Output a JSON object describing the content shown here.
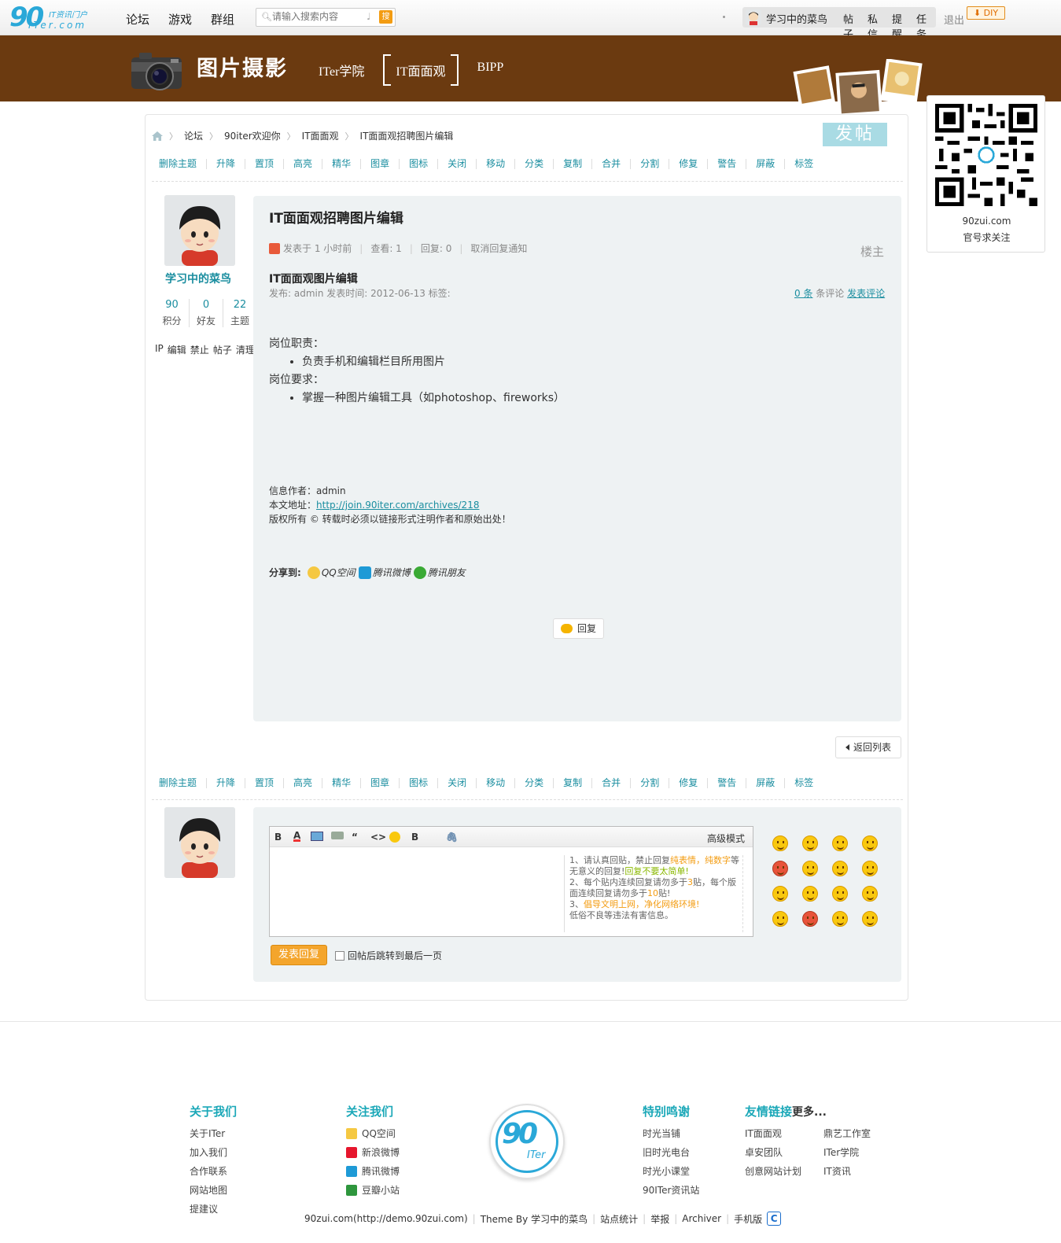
{
  "topnav": {
    "logo_text": "90",
    "logo_tagline": "IT资讯门户",
    "logo_domain": "ITer.com",
    "items": [
      "论坛",
      "游戏",
      "群组"
    ],
    "search_placeholder": "请输入搜索内容",
    "search_button": "搜",
    "username": "学习中的菜鸟",
    "user_links": [
      "帖子",
      "私信",
      "提醒",
      "任务"
    ],
    "logout": "退出",
    "diy": "DIY"
  },
  "banner": {
    "title": "图片摄影",
    "nav": [
      "ITer学院",
      "IT面面观",
      "BIPP"
    ],
    "active": "IT面面观"
  },
  "qr": {
    "site": "90zui.com",
    "caption": "官号求关注"
  },
  "breadcrumb": [
    "论坛",
    "90iter欢迎你",
    "IT面面观",
    "IT面面观招聘图片编辑"
  ],
  "post_button": "发帖",
  "mod_actions": [
    "删除主题",
    "升降",
    "置顶",
    "高亮",
    "精华",
    "图章",
    "图标",
    "关闭",
    "移动",
    "分类",
    "复制",
    "合并",
    "分割",
    "修复",
    "警告",
    "屏蔽",
    "标签"
  ],
  "author": {
    "name": "学习中的菜鸟",
    "stats": [
      {
        "value": "90",
        "label": "积分"
      },
      {
        "value": "0",
        "label": "好友"
      },
      {
        "value": "22",
        "label": "主题"
      }
    ],
    "links": [
      "IP",
      "编辑",
      "禁止",
      "帖子",
      "清理"
    ]
  },
  "post": {
    "title": "IT面面观招聘图片编辑",
    "posted": "发表于 1 小时前",
    "views": "查看: 1",
    "replies": "回复: 0",
    "unsubscribe": "取消回复通知",
    "floor": "楼主",
    "subtitle": "IT面面观图片编辑",
    "pubinfo": "发布: admin 发表时间: 2012-06-13 标签:",
    "comment_count": "0 条",
    "comment_label": "条评论",
    "comment_link": "发表评论",
    "duty_title": "岗位职责：",
    "duty_items": [
      "负责手机和编辑栏目所用图片"
    ],
    "req_title": "岗位要求：",
    "req_items": [
      "掌握一种图片编辑工具（如photoshop、fireworks）"
    ],
    "info_author": "信息作者：admin",
    "info_url_label": "本文地址：",
    "info_url": "http://join.90iter.com/archives/218",
    "copyright": "版权所有 © 转载时必须以链接形式注明作者和原始出处！",
    "share_label": "分享到:",
    "share_items": [
      "QQ空间",
      "腾讯微博",
      "腾讯朋友"
    ],
    "reply_button": "回复"
  },
  "back_list": "返回列表",
  "reply_form": {
    "advanced": "高级模式",
    "notice_1a": "请认真回贴，禁止回复",
    "notice_1b": "纯表情，纯数字",
    "notice_1c": "等无意义的回复!",
    "notice_1d": "回复不要太简单!",
    "notice_2a": "每个贴内连续回复请勿多于",
    "notice_2b": "3",
    "notice_2c": "贴，每个版面连续回复请勿多于",
    "notice_2d": "10",
    "notice_2e": "贴!",
    "notice_3a": "倡导文明上网，净化网络环境!",
    "notice_3b": "低俗不良等违法有害信息。",
    "submit": "发表回复",
    "jump_label": "回帖后跳转到最后一页"
  },
  "footer": {
    "about_title": "关于我们",
    "about_items": [
      "关于ITer",
      "加入我们",
      "合作联系",
      "网站地图",
      "提建议"
    ],
    "follow_title": "关注我们",
    "follow_items": [
      "QQ空间",
      "新浪微博",
      "腾讯微博",
      "豆瓣小站"
    ],
    "logo_text": "90",
    "logo_sub": "ITer",
    "thanks_title": "特别鸣谢",
    "thanks_items": [
      "时光当铺",
      "旧时光电台",
      "时光小课堂",
      "90ITer资讯站"
    ],
    "links_title": "友情链接",
    "links_more": "更多...",
    "links_col1": [
      "IT面面观",
      "卓安团队",
      "创意网站计划"
    ],
    "links_col2": [
      "鼎艺工作室",
      "ITer学院",
      "IT资讯"
    ],
    "bottom": [
      "90zui.com(http://demo.90zui.com)",
      "Theme By 学习中的菜鸟",
      "站点统计",
      "举报",
      "Archiver",
      "手机版"
    ]
  }
}
